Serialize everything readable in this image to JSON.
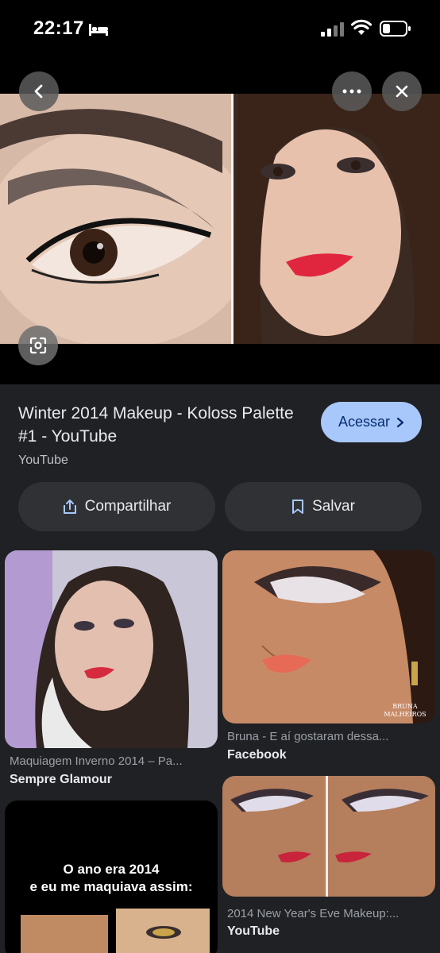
{
  "status_bar": {
    "time": "22:17",
    "icons": [
      "bed-icon",
      "signal-icon",
      "wifi-icon",
      "battery-icon"
    ]
  },
  "viewer": {
    "buttons": [
      "back-icon",
      "more-icon",
      "close-icon",
      "lens-icon"
    ]
  },
  "result": {
    "title": "Winter 2014 Makeup - Koloss Palette #1 - YouTube",
    "source": "YouTube",
    "visit_label": "Acessar",
    "share_label": "Compartilhar",
    "save_label": "Salvar"
  },
  "related": [
    {
      "caption": "Maquiagem Inverno 2014 – Pa...",
      "site": "Sempre Glamour"
    },
    {
      "caption": "Bruna - E aí gostaram dessa...",
      "site": "Facebook",
      "watermark": "BRUNA MALHEIROS"
    },
    {
      "caption": "",
      "site": "",
      "overlay_line1": "O ano era 2014",
      "overlay_line2": "e eu me maquiava assim:"
    },
    {
      "caption": "2014 New Year's Eve Makeup:...",
      "site": "YouTube"
    }
  ],
  "colors": {
    "panel_bg": "#202124",
    "button_bg": "#303134",
    "accent": "#a8c7fa",
    "accent_text": "#062e6f"
  }
}
